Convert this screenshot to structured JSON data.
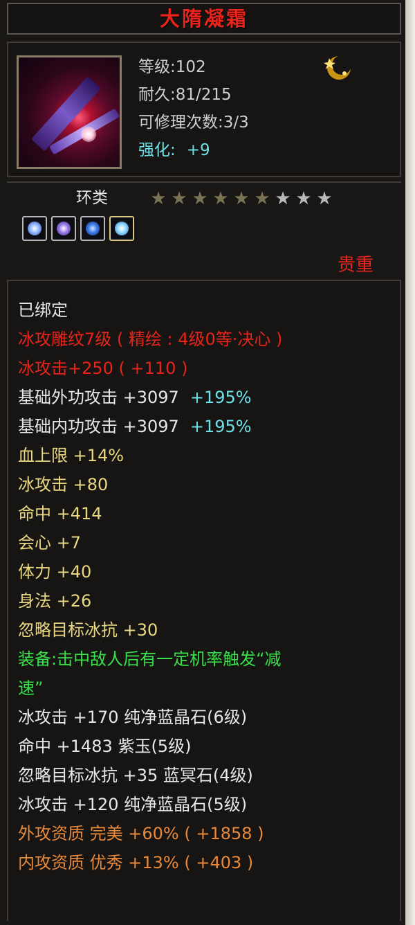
{
  "title": "大隋凝霜",
  "head": {
    "level": "等级:102",
    "durability": "耐久:81/215",
    "repairs": "可修理次数:3/3",
    "enhance_label": "强化:",
    "enhance_value": "+9"
  },
  "tier": {
    "label": "环类",
    "stars_filled": 6,
    "stars_total": 9
  },
  "gems": [
    "gem-icon-1",
    "gem-icon-2",
    "gem-icon-3",
    "gem-icon-4"
  ],
  "rarity": "贵重",
  "colors": {
    "red": "#e8241c",
    "yellow": "#e9d782",
    "green": "#39e04a",
    "orange": "#e98a3a",
    "cyan": "#6fe0e8",
    "white": "#e8e8e8"
  },
  "attributes": {
    "bound": "已绑定",
    "engrave": "冰攻雕纹7级 ( 精绘 : 4级0等·决心 )",
    "ice_attack_engrave": "冰攻击+250 ( +110 )",
    "ext_attack": "基础外功攻击 +3097",
    "ext_attack_pct": "+195%",
    "int_attack": "基础内功攻击 +3097",
    "int_attack_pct": "+195%",
    "hp_limit": "血上限 +14%",
    "ice_attack": "冰攻击 +80",
    "hit": "命中 +414",
    "crit": "会心 +7",
    "stamina": "体力 +40",
    "agility": "身法 +26",
    "ignore_ice": "忽略目标冰抗 +30",
    "equip_effect_1": "装备:击中敌人后有一定机率触发“减",
    "equip_effect_2": "速”",
    "gem_1": "冰攻击 +170 纯净蓝晶石(6级)",
    "gem_2": "命中 +1483 紫玉(5级)",
    "gem_3": "忽略目标冰抗 +35 蓝冥石(4级)",
    "gem_4": "冰攻击 +120 纯净蓝晶石(5级)",
    "ext_quality": "外攻资质  完美 +60% ( +1858 )",
    "int_quality": "内攻资质  优秀 +13% ( +403 )"
  }
}
